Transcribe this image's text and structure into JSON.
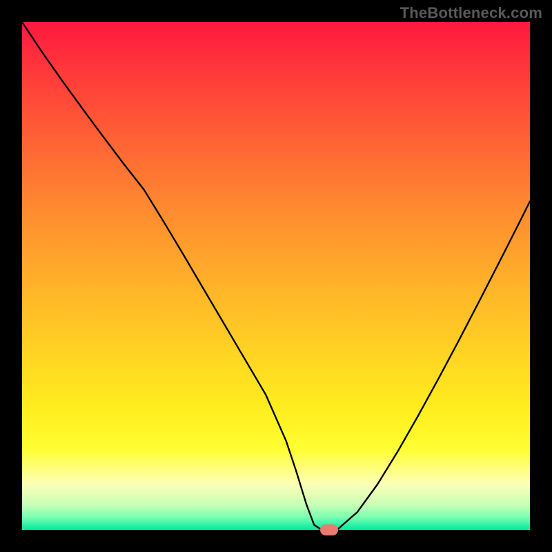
{
  "attribution": "TheBottleneck.com",
  "colors": {
    "frame": "#000000",
    "curve": "#000000",
    "marker": "#e97b70",
    "gradient_top": "#ff183f",
    "gradient_bottom": "#00e8a0"
  },
  "chart_data": {
    "type": "line",
    "title": "",
    "xlabel": "",
    "ylabel": "",
    "xlim": [
      0,
      100
    ],
    "ylim": [
      0,
      100
    ],
    "x": [
      0,
      4,
      8,
      12,
      16,
      20,
      24,
      28,
      32,
      36,
      40,
      44,
      48,
      52,
      54,
      56,
      57.5,
      59,
      62,
      66,
      70,
      74,
      78,
      82,
      86,
      90,
      94,
      98,
      100
    ],
    "values": [
      100,
      94,
      88.3,
      82.8,
      77.4,
      72.1,
      67,
      60.5,
      53.8,
      47,
      40.2,
      33.4,
      26.6,
      17.5,
      11.5,
      5,
      1,
      0,
      0,
      3.5,
      9,
      15.5,
      22.5,
      29.8,
      37.3,
      45,
      52.8,
      60.7,
      64.7
    ],
    "marker": {
      "x": 60.5,
      "y": 0
    },
    "grid": false,
    "legend": false
  }
}
